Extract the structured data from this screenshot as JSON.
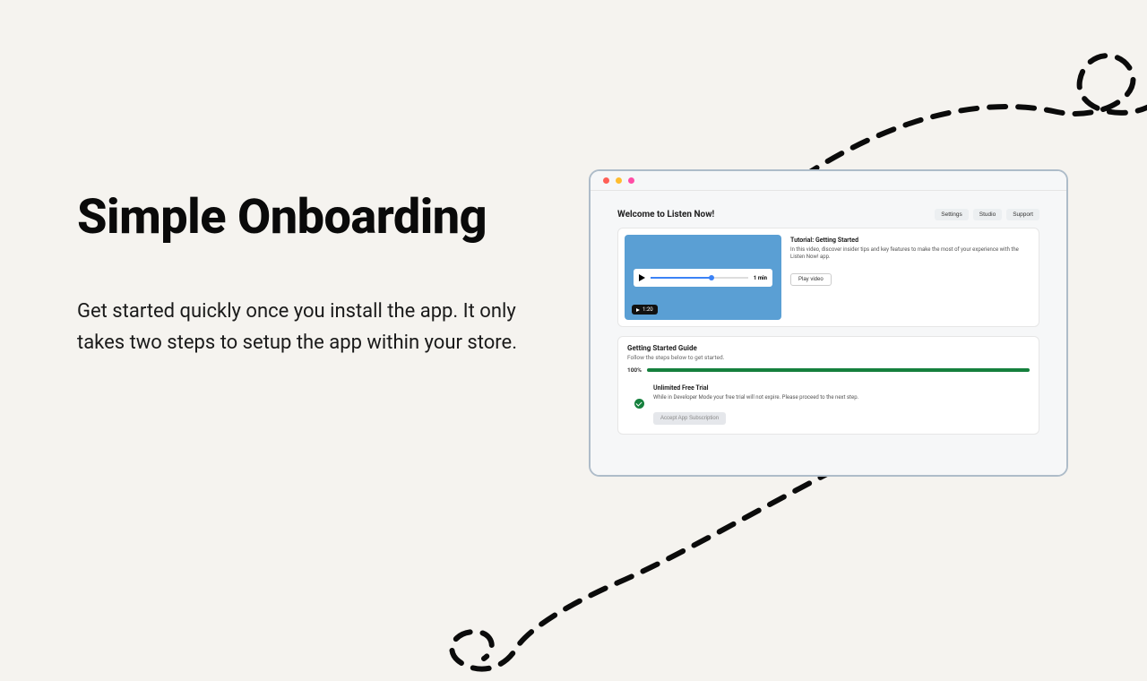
{
  "hero": {
    "title": "Simple Onboarding",
    "description": "Get started quickly once you install the app. It only takes two steps to setup the app within your store."
  },
  "app": {
    "title": "Welcome to Listen Now!",
    "nav": {
      "settings": "Settings",
      "studio": "Studio",
      "support": "Support"
    }
  },
  "tutorial": {
    "title": "Tutorial: Getting Started",
    "description": "In this video, discover insider tips and key features to make the most of your experience with the Listen Now! app.",
    "play_label": "Play video",
    "duration_bar": "1 min",
    "badge_time": "1:20"
  },
  "guide": {
    "title": "Getting Started Guide",
    "subtitle": "Follow the steps below to get started.",
    "progress_pct": "100%"
  },
  "step": {
    "title": "Unlimited Free Trial",
    "description": "While in Developer Mode your free trial will not expire. Please proceed to the next step.",
    "button_label": "Accept App Subscription"
  }
}
